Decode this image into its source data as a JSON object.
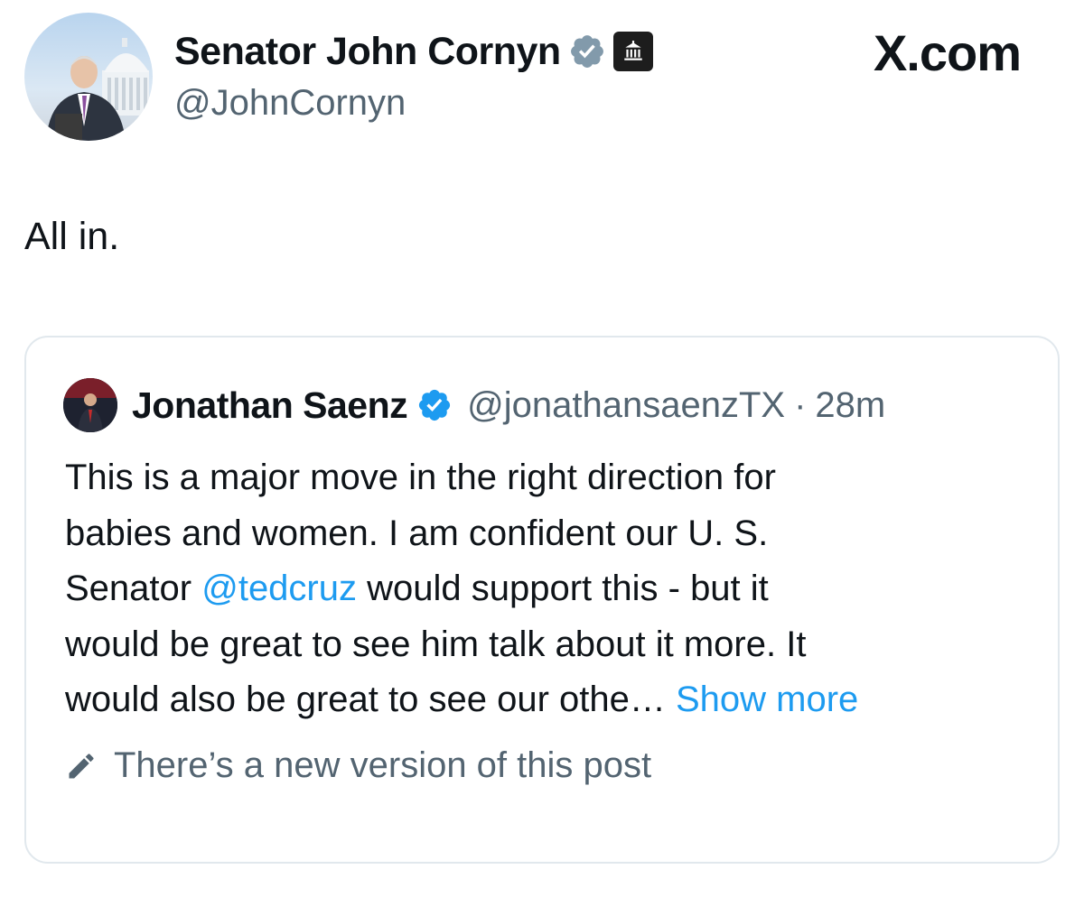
{
  "post": {
    "author": {
      "name": "Senator John Cornyn",
      "handle": "@JohnCornyn",
      "verified_badge": "verified-gray-icon",
      "affiliation_badge": "government-building-icon"
    },
    "brand": "X.com",
    "text": "All in."
  },
  "quote": {
    "author": {
      "name": "Jonathan Saenz",
      "handle": "@jonathansaenzTX",
      "separator": "·",
      "time": "28m",
      "verified_badge": "verified-blue-icon"
    },
    "body": {
      "line1": "This is a major move in the right direction for",
      "line2": "babies and women. I am confident our  U. S.",
      "line3_pre": "Senator ",
      "line3_mention": "@tedcruz",
      "line3_post": " would support this - but it",
      "line4": "would be great to see him talk about it more. It",
      "line5": "would also be great to see our othe…",
      "show_more": "Show more"
    },
    "edit_notice": {
      "icon": "pencil-icon",
      "text": "There’s a new version of this post"
    }
  },
  "colors": {
    "text": "#0f1419",
    "secondary": "#536471",
    "link": "#1d9bf0",
    "border": "#e1e8ed",
    "verified_gray": "#829aab"
  }
}
